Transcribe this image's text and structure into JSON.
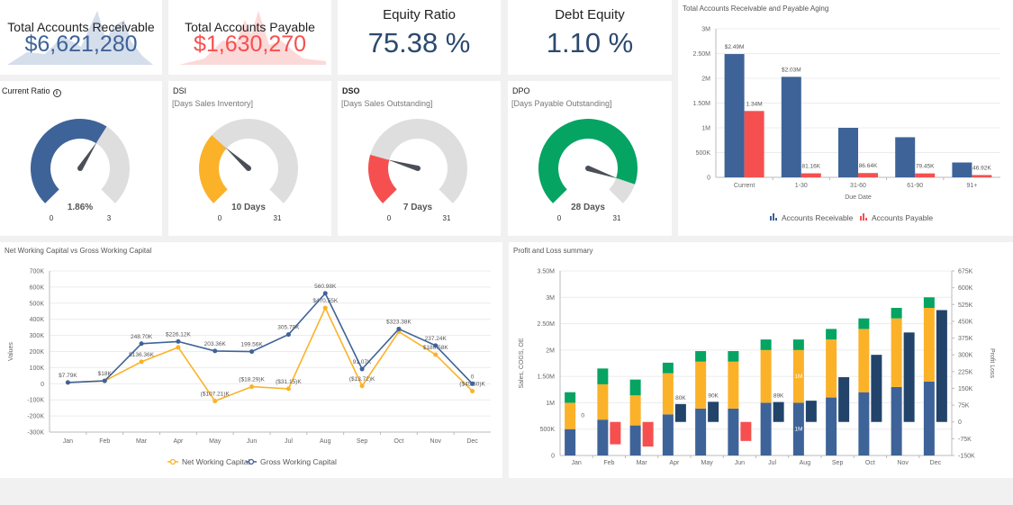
{
  "kpis": {
    "receivable": {
      "title": "Total Accounts Receivable",
      "value": "$6,621,280",
      "color": "#3e6398",
      "spark_color": "#d5deeb"
    },
    "payable": {
      "title": "Total Accounts Payable",
      "value": "$1,630,270",
      "color": "#f5504f",
      "spark_color": "#fcd9d9"
    },
    "equity_ratio": {
      "title": "Equity Ratio",
      "value": "75.38 %",
      "color": "#2d4a6e"
    },
    "debt_equity": {
      "title": "Debt Equity",
      "value": "1.10 %",
      "color": "#2d4a6e"
    }
  },
  "gauges": [
    {
      "id": "current-ratio",
      "title": "Current Ratio",
      "subtitle": "",
      "value_label": "1.86%",
      "min": "0",
      "max": "3",
      "value": 1.86,
      "range": 3,
      "color": "#3e6398",
      "info_icon": "i"
    },
    {
      "id": "dsi",
      "title": "DSI",
      "subtitle": "[Days Sales Inventory]",
      "value_label": "10 Days",
      "min": "0",
      "max": "31",
      "value": 10,
      "range": 31,
      "color": "#fbb229"
    },
    {
      "id": "dso",
      "title": "DSO",
      "subtitle": "[Days Sales Outstanding]",
      "value_label": "7 Days",
      "min": "0",
      "max": "31",
      "value": 7,
      "range": 31,
      "color": "#f5504f"
    },
    {
      "id": "dpo",
      "title": "DPO",
      "subtitle": "[Days Payable Outstanding]",
      "value_label": "28 Days",
      "min": "0",
      "max": "31",
      "value": 28,
      "range": 31,
      "color": "#05a463"
    }
  ],
  "chart_data": [
    {
      "id": "aging",
      "type": "bar",
      "title": "Total Accounts Receivable and Payable Aging",
      "xlabel": "Due Date",
      "ylabel": "",
      "categories": [
        "Current",
        "1-30",
        "31-60",
        "61-90",
        "91+"
      ],
      "ylim": [
        0,
        3000000
      ],
      "yticks": [
        0,
        500000,
        1000000,
        1500000,
        2000000,
        2500000,
        3000000
      ],
      "ytick_labels": [
        "0",
        "500K",
        "1M",
        "1.50M",
        "2M",
        "2.50M",
        "3M"
      ],
      "series": [
        {
          "name": "Accounts Receivable",
          "color": "#3e6398",
          "values": [
            2490000,
            2030000,
            1000000,
            810000,
            300000
          ],
          "labels": [
            "$2.49M",
            "$2.03M",
            "",
            "",
            ""
          ]
        },
        {
          "name": "Accounts Payable",
          "color": "#f5504f",
          "values": [
            1340000,
            81160,
            86640,
            79450,
            46920
          ],
          "labels": [
            "1.34M",
            "81.16K",
            "86.64K",
            "79.45K",
            "46.92K"
          ]
        }
      ],
      "legend": "bottom"
    },
    {
      "id": "working-capital",
      "type": "line",
      "title": "Net Working Capital vs Gross Working Capital",
      "xlabel": "",
      "ylabel": "Values",
      "categories": [
        "Jan",
        "Feb",
        "Mar",
        "Apr",
        "May",
        "Jun",
        "Jul",
        "Aug",
        "Sep",
        "Oct",
        "Nov",
        "Dec"
      ],
      "ylim": [
        -300000,
        700000
      ],
      "yticks": [
        -300000,
        -200000,
        -100000,
        0,
        100000,
        200000,
        300000,
        400000,
        500000,
        600000,
        700000
      ],
      "ytick_labels": [
        "-300K",
        "-200K",
        "-100K",
        "0",
        "100K",
        "200K",
        "300K",
        "400K",
        "500K",
        "600K",
        "700K"
      ],
      "series": [
        {
          "name": "Net Working Capital",
          "color": "#fbb229",
          "values": [
            7790,
            18000,
            136360,
            226120,
            -107210,
            -18290,
            -31150,
            470550,
            -13720,
            323380,
            180580,
            -45600
          ],
          "labels": [
            "",
            "",
            "$136.36K",
            "",
            "($107.21)K",
            "($18.29)K",
            "($31.15)K",
            "$470.55K",
            "($13.72)K",
            "",
            "$180.58K",
            "($45.60)K"
          ]
        },
        {
          "name": "Gross Working Capital",
          "color": "#3e6398",
          "values": [
            7790,
            18000,
            248700,
            262000,
            203360,
            199560,
            305790,
            560980,
            91070,
            340000,
            237240,
            0
          ],
          "labels": [
            "$7.79K",
            "$18K",
            "248.70K",
            "$226.12K",
            "203.36K",
            "199.56K",
            "305.79K",
            "560.98K",
            "91.07K",
            "$323.38K",
            "237.24K",
            "0"
          ]
        }
      ],
      "legend": "bottom"
    },
    {
      "id": "pnl",
      "type": "bar",
      "title": "Profit and Loss summary",
      "xlabel": "",
      "ylabel": "Sales, COGS, OE",
      "y2label": "Profit Loss",
      "categories": [
        "Jan",
        "Feb",
        "Mar",
        "Apr",
        "May",
        "Jun",
        "Jul",
        "Aug",
        "Sep",
        "Oct",
        "Nov",
        "Dec"
      ],
      "ylim": [
        0,
        3500000
      ],
      "yticks": [
        0,
        500000,
        1000000,
        1500000,
        2000000,
        2500000,
        3000000,
        3500000
      ],
      "ytick_labels": [
        "0",
        "500K",
        "1M",
        "1.50M",
        "2M",
        "2.50M",
        "3M",
        "3.50M"
      ],
      "y2lim": [
        -150000,
        675000
      ],
      "y2ticks": [
        -150000,
        -75000,
        0,
        75000,
        150000,
        225000,
        300000,
        375000,
        450000,
        525000,
        600000,
        675000
      ],
      "y2tick_labels": [
        "-150K",
        "-75K",
        "0",
        "75K",
        "150K",
        "225K",
        "300K",
        "375K",
        "450K",
        "525K",
        "600K",
        "675K"
      ],
      "stacked_series": [
        {
          "name": "Sales",
          "color": "#3e6398",
          "values": [
            500000,
            680000,
            570000,
            780000,
            890000,
            890000,
            1000000,
            1000000,
            1100000,
            1200000,
            1300000,
            1400000
          ]
        },
        {
          "name": "COGS",
          "color": "#fbb229",
          "values": [
            500000,
            670000,
            570000,
            780000,
            890000,
            890000,
            1000000,
            1000000,
            1100000,
            1200000,
            1300000,
            1400000
          ]
        },
        {
          "name": "OE",
          "color": "#05a463",
          "values": [
            200000,
            300000,
            300000,
            200000,
            200000,
            200000,
            200000,
            200000,
            200000,
            200000,
            200000,
            200000
          ]
        }
      ],
      "profit_loss": {
        "profit_color": "#22436a",
        "loss_color": "#f5504f",
        "values": [
          0,
          -100000,
          -110000,
          80000,
          90000,
          -85000,
          89000,
          95000,
          200000,
          300000,
          400000,
          500000
        ],
        "labels": [
          "0",
          "",
          "",
          "80K",
          "90K",
          "",
          "89K",
          "",
          "",
          "",
          "",
          ""
        ]
      },
      "inner_labels": {
        "Aug_cogs": "1M",
        "Aug_sales": "1M"
      }
    }
  ]
}
